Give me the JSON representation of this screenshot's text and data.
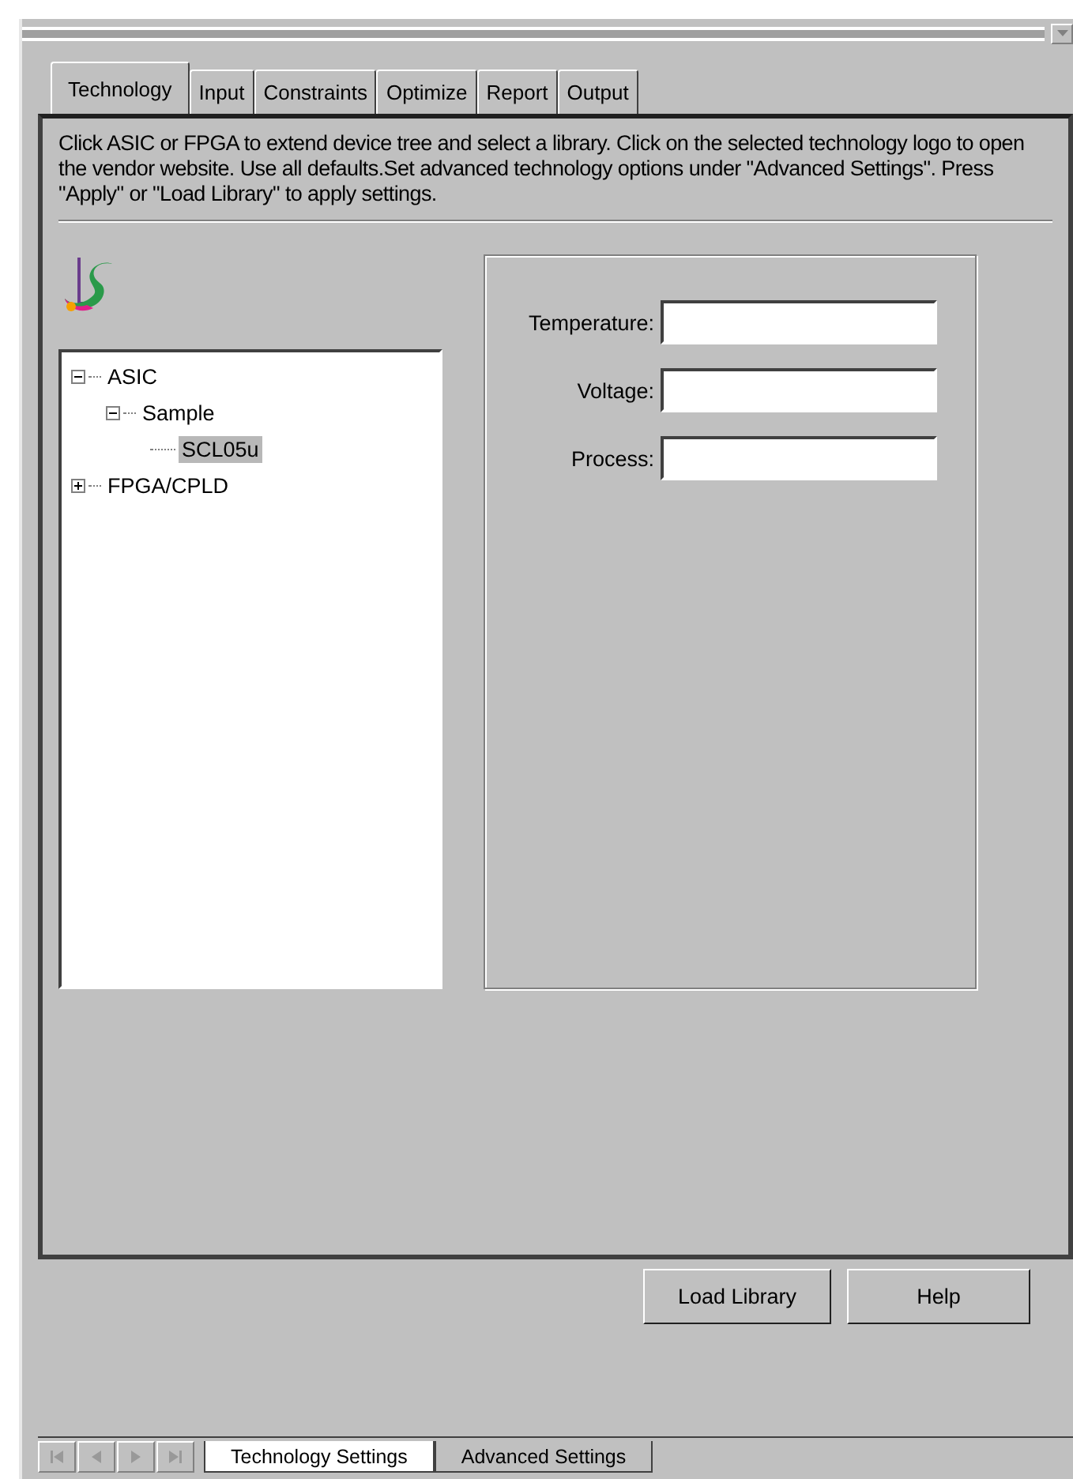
{
  "tabs": [
    {
      "label": "Technology",
      "selected": true
    },
    {
      "label": "Input",
      "selected": false
    },
    {
      "label": "Constraints",
      "selected": false
    },
    {
      "label": "Optimize",
      "selected": false
    },
    {
      "label": "Report",
      "selected": false
    },
    {
      "label": "Output",
      "selected": false
    }
  ],
  "description": "Click ASIC or FPGA to extend device tree and select a library. Click on the selected technology logo to open the vendor website. Use all defaults.Set advanced technology options under \"Advanced Settings\". Press \"Apply\" or \"Load Library\" to apply settings.",
  "tree": [
    {
      "label": "ASIC",
      "kind": "folder",
      "expanded": true,
      "selected": false,
      "children": [
        {
          "label": "Sample",
          "kind": "folder",
          "expanded": true,
          "selected": false,
          "children": [
            {
              "label": "SCL05u",
              "kind": "leaf",
              "selected": true
            }
          ]
        }
      ]
    },
    {
      "label": "FPGA/CPLD",
      "kind": "folder",
      "expanded": false,
      "selected": false
    }
  ],
  "fields": [
    {
      "label": "Temperature:"
    },
    {
      "label": "Voltage:"
    },
    {
      "label": "Process:"
    }
  ],
  "buttons": [
    "Load Library",
    "Help"
  ],
  "sheet_tabs": [
    {
      "label": "Technology Settings",
      "selected": true
    },
    {
      "label": "Advanced Settings",
      "selected": false
    }
  ]
}
